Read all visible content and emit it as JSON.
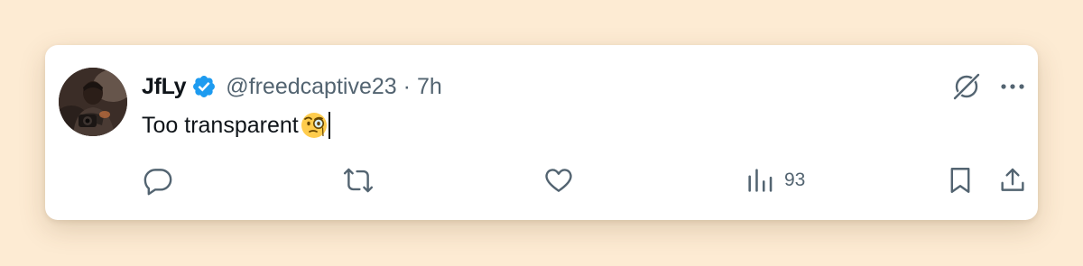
{
  "tweet": {
    "author_name": "JfLy",
    "handle": "@freedcaptive23",
    "separator": "·",
    "time": "7h",
    "text": "Too transparent",
    "emoji": "face-with-monocle"
  },
  "actions": {
    "views_count": "93"
  },
  "colors": {
    "page_background": "#fdebd3",
    "card_background": "#ffffff",
    "primary_text": "#0f1419",
    "secondary_text": "#536471",
    "verified_badge": "#1d9bf0"
  }
}
